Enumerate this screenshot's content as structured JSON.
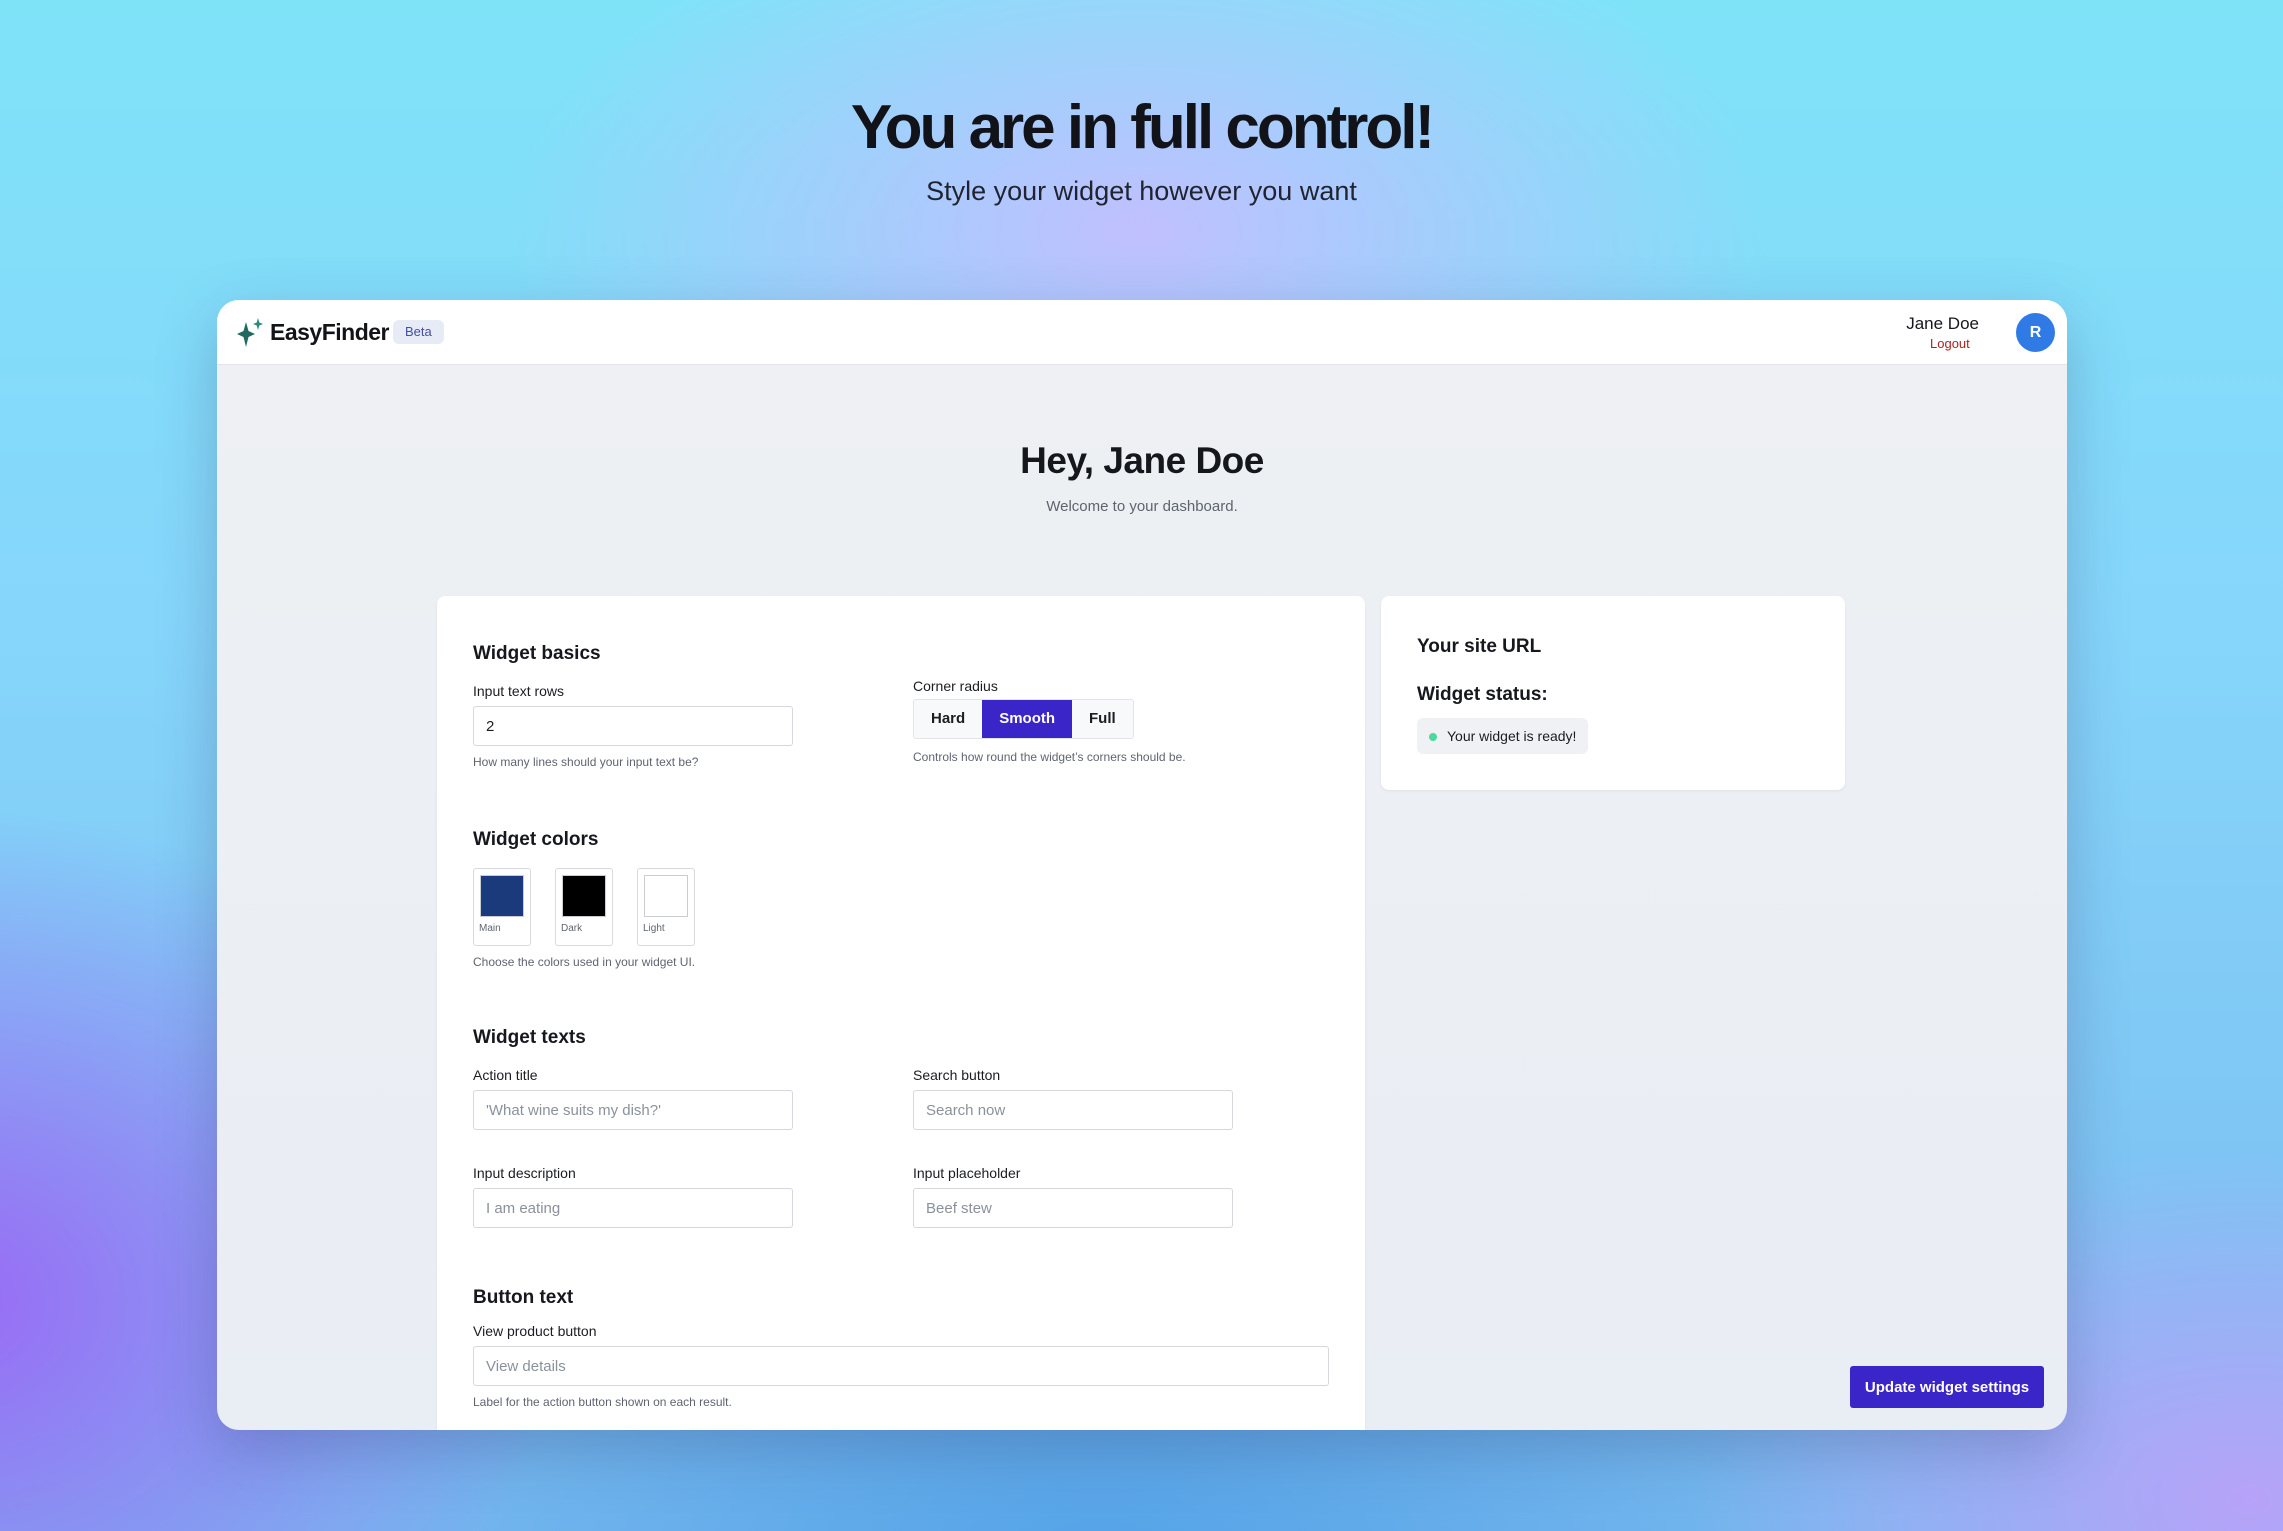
{
  "hero": {
    "title": "You are in full control!",
    "subtitle": "Style your widget however you want"
  },
  "header": {
    "brand": "EasyFinder",
    "badge": "Beta",
    "user_name": "Jane Doe",
    "logout": "Logout",
    "avatar_initial": "R"
  },
  "dashboard": {
    "greeting": "Hey, Jane Doe",
    "welcome": "Welcome to your dashboard."
  },
  "basics": {
    "title": "Widget basics",
    "rows_label": "Input text rows",
    "rows_value": "2",
    "rows_help": "How many lines should your input text be?",
    "radius_label": "Corner radius",
    "radius_options": [
      "Hard",
      "Smooth",
      "Full"
    ],
    "radius_selected": "Smooth",
    "radius_help": "Controls how round the widget’s corners should be."
  },
  "colors": {
    "title": "Widget colors",
    "swatches": [
      {
        "label": "Main",
        "color": "#1b3a7c"
      },
      {
        "label": "Dark",
        "color": "#000000"
      },
      {
        "label": "Light",
        "color": "#ffffff"
      }
    ],
    "help": "Choose the colors used in your widget UI."
  },
  "texts": {
    "title": "Widget texts",
    "action_title_label": "Action title",
    "action_title_placeholder": "'What wine suits my dish?'",
    "search_button_label": "Search button",
    "search_button_placeholder": "Search now",
    "input_description_label": "Input description",
    "input_description_placeholder": "I am eating",
    "input_placeholder_label": "Input placeholder",
    "input_placeholder_placeholder": "Beef stew"
  },
  "button_text": {
    "title": "Button text",
    "view_product_label": "View product button",
    "view_product_placeholder": "View details",
    "help": "Label for the action button shown on each result."
  },
  "sidebar": {
    "site_url_title": "Your site URL",
    "status_title": "Widget status:",
    "status_text": "Your widget is ready!"
  },
  "actions": {
    "update": "Update widget settings"
  },
  "colors_theme": {
    "accent": "#3a25c8",
    "avatar": "#2f7ae5",
    "logout": "#b11f1f",
    "status_ok": "#4fd89a"
  }
}
